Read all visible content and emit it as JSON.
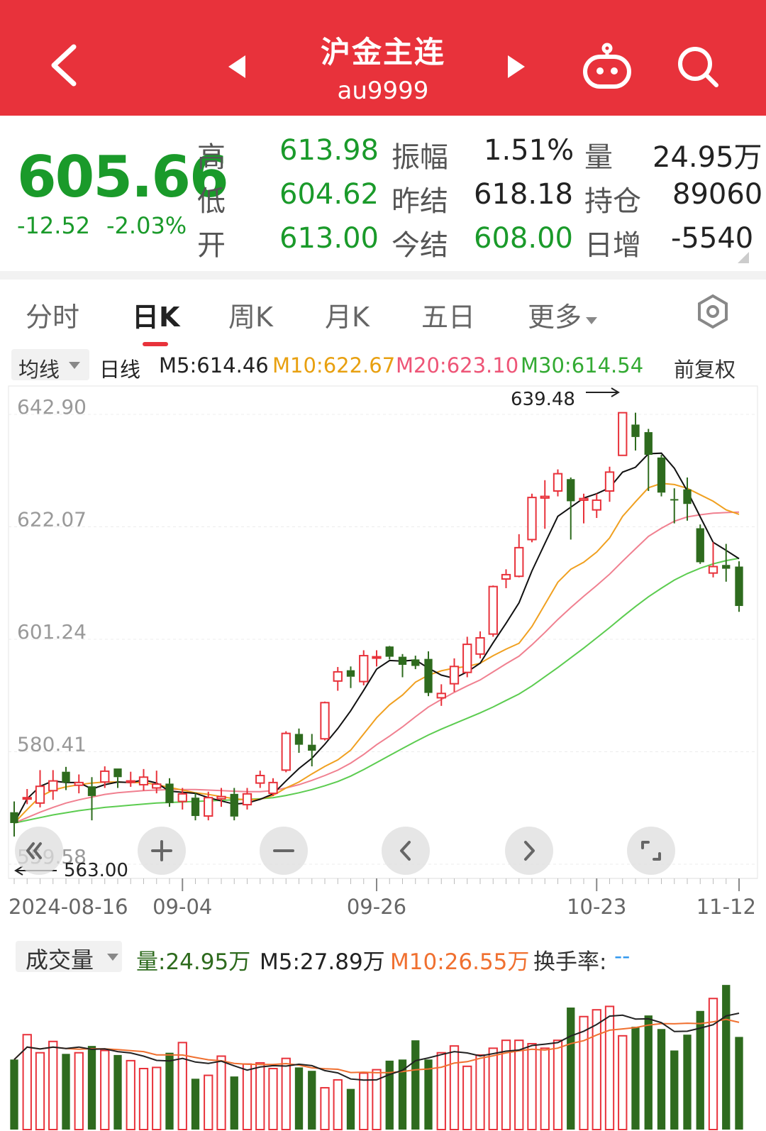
{
  "header": {
    "title": "沪金主连",
    "code": "au9999",
    "icons": [
      "back-arrow-icon",
      "prev-triangle-icon",
      "next-triangle-icon",
      "robot-icon",
      "search-icon"
    ]
  },
  "quote": {
    "price": "605.66",
    "change": "-12.52",
    "change_pct": "-2.03%",
    "rows": [
      {
        "l1": "高",
        "v1": "613.98",
        "l2": "振幅",
        "v2": "1.51%",
        "l3": "量",
        "v3": "24.95万"
      },
      {
        "l1": "低",
        "v1": "604.62",
        "l2": "昨结",
        "v2": "618.18",
        "l3": "持仓",
        "v3": "89060"
      },
      {
        "l1": "开",
        "v1": "613.00",
        "l2": "今结",
        "v2": "608.00",
        "l3": "日增",
        "v3": "-5540"
      }
    ]
  },
  "tabs": [
    "分时",
    "日K",
    "周K",
    "月K",
    "五日",
    "更多"
  ],
  "ma_bar": {
    "selector": "均线",
    "period": "日线",
    "m5": "M5:614.46",
    "m10": "M10:622.67",
    "m20": "M20:623.10",
    "m30": "M30:614.54",
    "adjust": "前复权"
  },
  "controls": [
    "rewind-icon",
    "zoom-in-icon",
    "zoom-out-icon",
    "left-icon",
    "right-icon",
    "fullscreen-icon"
  ],
  "vol_bar": {
    "selector": "成交量",
    "vol": "量:24.95万",
    "m5": "M5:27.89万",
    "m10": "M10:26.55万",
    "turnover": "换手率:",
    "turnover_val": "--"
  },
  "colors": {
    "up": "#e8323b",
    "down": "#2e6b1e",
    "ma5": "#111111",
    "ma10": "#f0a020",
    "ma20": "#f08090",
    "ma30": "#5ccc50",
    "header": "#e8323b"
  },
  "chart_data": {
    "type": "candlestick",
    "y_ticks": [
      "642.90",
      "622.07",
      "601.24",
      "580.41",
      "559.58"
    ],
    "ylim": [
      559.58,
      642.9
    ],
    "x_ticks": [
      "2024-08-16",
      "09-04",
      "09-26",
      "10-23",
      "11-12"
    ],
    "max_label": "639.48",
    "min_label": "563.00",
    "candles": [
      [
        567.5,
        565.5,
        569.5,
        563.0
      ],
      [
        570.0,
        570.2,
        571.8,
        569.0
      ],
      [
        569.2,
        572.3,
        575.3,
        568.4
      ],
      [
        571.5,
        573.3,
        575.3,
        569.8
      ],
      [
        575.0,
        573.0,
        575.9,
        571.6
      ],
      [
        572.5,
        573.0,
        574.5,
        571.0
      ],
      [
        572.3,
        570.5,
        574.0,
        566.0
      ],
      [
        573.1,
        575.1,
        576.0,
        572.0
      ],
      [
        575.6,
        574.0,
        575.6,
        572.0
      ],
      [
        573.1,
        573.3,
        575.0,
        572.2
      ],
      [
        572.6,
        574.0,
        575.5,
        571.5
      ],
      [
        572.0,
        572.7,
        575.2,
        571.0
      ],
      [
        572.8,
        569.2,
        573.8,
        568.5
      ],
      [
        569.5,
        570.9,
        572.0,
        568.0
      ],
      [
        570.2,
        566.8,
        571.1,
        566.0
      ],
      [
        566.8,
        570.2,
        571.3,
        566.0
      ],
      [
        570.0,
        570.4,
        572.0,
        568.5
      ],
      [
        570.9,
        566.7,
        572.0,
        566.0
      ],
      [
        568.9,
        570.9,
        572.0,
        568.0
      ],
      [
        572.9,
        574.3,
        575.2,
        572.0
      ],
      [
        571.0,
        573.0,
        573.8,
        570.5
      ],
      [
        575.3,
        582.1,
        582.5,
        574.9
      ],
      [
        582.0,
        580.0,
        583.0,
        578.5
      ],
      [
        580.0,
        578.9,
        582.0,
        576.0
      ],
      [
        581.1,
        587.8,
        588.0,
        580.8
      ],
      [
        591.8,
        593.5,
        594.4,
        590.0
      ],
      [
        593.8,
        592.6,
        594.5,
        590.5
      ],
      [
        591.7,
        596.5,
        597.5,
        591.0
      ],
      [
        596.1,
        596.3,
        597.5,
        594.5
      ],
      [
        598.2,
        596.3,
        598.3,
        595.8
      ],
      [
        596.3,
        594.8,
        596.8,
        592.5
      ],
      [
        595.8,
        594.6,
        596.5,
        594.0
      ],
      [
        595.9,
        589.6,
        597.3,
        589.0
      ],
      [
        588.7,
        589.5,
        591.2,
        587.2
      ],
      [
        591.3,
        594.5,
        596.0,
        589.8
      ],
      [
        593.4,
        598.6,
        600.0,
        592.5
      ],
      [
        596.8,
        599.8,
        601.0,
        596.0
      ],
      [
        600.5,
        609.3,
        609.5,
        600.0
      ],
      [
        610.7,
        611.5,
        612.5,
        609.0
      ],
      [
        611.2,
        616.5,
        619.0,
        611.0
      ],
      [
        618.0,
        625.8,
        626.5,
        617.5
      ],
      [
        625.7,
        626.0,
        629.0,
        620.0
      ],
      [
        627.0,
        630.2,
        631.0,
        626.0
      ],
      [
        629.2,
        625.1,
        629.5,
        618.0
      ],
      [
        625.3,
        625.6,
        626.5,
        621.0
      ],
      [
        623.5,
        625.3,
        626.5,
        622.0
      ],
      [
        627.0,
        630.5,
        631.5,
        625.0
      ],
      [
        633.6,
        641.5,
        641.5,
        633.5
      ],
      [
        639.3,
        637.0,
        641.5,
        634.5
      ],
      [
        637.9,
        633.7,
        638.5,
        627.0
      ],
      [
        633.2,
        626.7,
        633.7,
        626.0
      ],
      [
        625.5,
        625.4,
        627.5,
        621.0
      ],
      [
        627.3,
        624.6,
        629.5,
        621.5
      ],
      [
        620.1,
        613.8,
        620.8,
        613.5
      ],
      [
        611.8,
        613.0,
        617.5,
        611.0
      ],
      [
        613.3,
        612.6,
        617.2,
        610.2
      ],
      [
        613.0,
        605.7,
        613.98,
        604.62
      ]
    ],
    "ma5": [
      565.5,
      570.0,
      572.3,
      573.3,
      573.0,
      573.0,
      571.8,
      572.6,
      573.1,
      573.0,
      573.5,
      572.9,
      571.4,
      571.2,
      571.0,
      570.2,
      569.6,
      569.0,
      569.2,
      569.9,
      570.9,
      573.3,
      575.6,
      577.5,
      580.1,
      583.0,
      586.3,
      590.1,
      594.0,
      595.6,
      595.5,
      595.7,
      594.2,
      592.9,
      592.3,
      593.5,
      595.1,
      598.9,
      602.5,
      606.3,
      612.2,
      617.3,
      622.3,
      624.0,
      625.7,
      626.5,
      627.6,
      630.5,
      631.4,
      633.9,
      634.0,
      631.2,
      627.0,
      622.2,
      617.5,
      616.0,
      614.46
    ],
    "ma10": [
      565.5,
      568.0,
      570.4,
      571.6,
      572.2,
      572.6,
      572.9,
      573.1,
      573.1,
      573.0,
      573.0,
      572.6,
      572.1,
      571.6,
      571.1,
      570.8,
      570.4,
      570.0,
      569.8,
      569.9,
      570.6,
      572.0,
      573.1,
      574.6,
      576.0,
      577.2,
      579.0,
      582.0,
      585.0,
      587.4,
      589.2,
      591.6,
      592.9,
      593.7,
      594.2,
      594.5,
      595.1,
      596.5,
      597.7,
      598.8,
      601.9,
      606.0,
      610.1,
      612.5,
      613.8,
      615.7,
      618.3,
      622.3,
      625.0,
      627.6,
      628.4,
      628.2,
      627.5,
      626.3,
      625.1,
      623.5,
      622.67
    ],
    "ma20": [
      565.5,
      566.5,
      567.5,
      568.4,
      569.2,
      569.8,
      570.3,
      570.8,
      571.1,
      571.3,
      571.5,
      571.6,
      571.7,
      571.7,
      571.7,
      571.6,
      571.5,
      571.4,
      571.3,
      571.3,
      571.5,
      572.0,
      572.6,
      573.4,
      574.3,
      575.3,
      576.6,
      578.2,
      580.0,
      581.6,
      583.3,
      585.2,
      587.0,
      588.4,
      589.7,
      590.9,
      592.0,
      593.5,
      595.0,
      596.4,
      598.5,
      600.8,
      603.2,
      605.4,
      607.5,
      609.5,
      611.6,
      614.0,
      616.3,
      618.6,
      620.1,
      621.4,
      622.2,
      622.6,
      622.9,
      623.0,
      623.1
    ],
    "ma30": [
      565.5,
      566.0,
      566.5,
      567.0,
      567.4,
      567.8,
      568.1,
      568.4,
      568.6,
      568.8,
      569.0,
      569.2,
      569.3,
      569.4,
      569.5,
      569.6,
      569.7,
      569.8,
      569.9,
      570.0,
      570.2,
      570.6,
      571.1,
      571.7,
      572.4,
      573.2,
      574.2,
      575.4,
      576.7,
      578.0,
      579.3,
      580.6,
      581.8,
      582.9,
      583.9,
      584.9,
      585.9,
      587.0,
      588.2,
      589.4,
      590.9,
      592.6,
      594.3,
      596.1,
      597.9,
      599.8,
      601.7,
      603.7,
      605.6,
      607.4,
      609.0,
      610.5,
      611.7,
      612.7,
      613.5,
      614.1,
      614.54
    ],
    "volume": [
      62,
      84,
      68,
      78,
      67,
      68,
      74,
      70,
      66,
      61,
      54,
      55,
      68,
      77,
      45,
      48,
      65,
      47,
      58,
      59,
      54,
      63,
      55,
      52,
      37,
      44,
      36,
      50,
      53,
      61,
      62,
      79,
      62,
      68,
      74,
      56,
      66,
      72,
      79,
      79,
      76,
      72,
      79,
      108,
      100,
      106,
      109,
      83,
      91,
      101,
      89,
      70,
      84,
      105,
      116,
      128,
      82
    ]
  }
}
